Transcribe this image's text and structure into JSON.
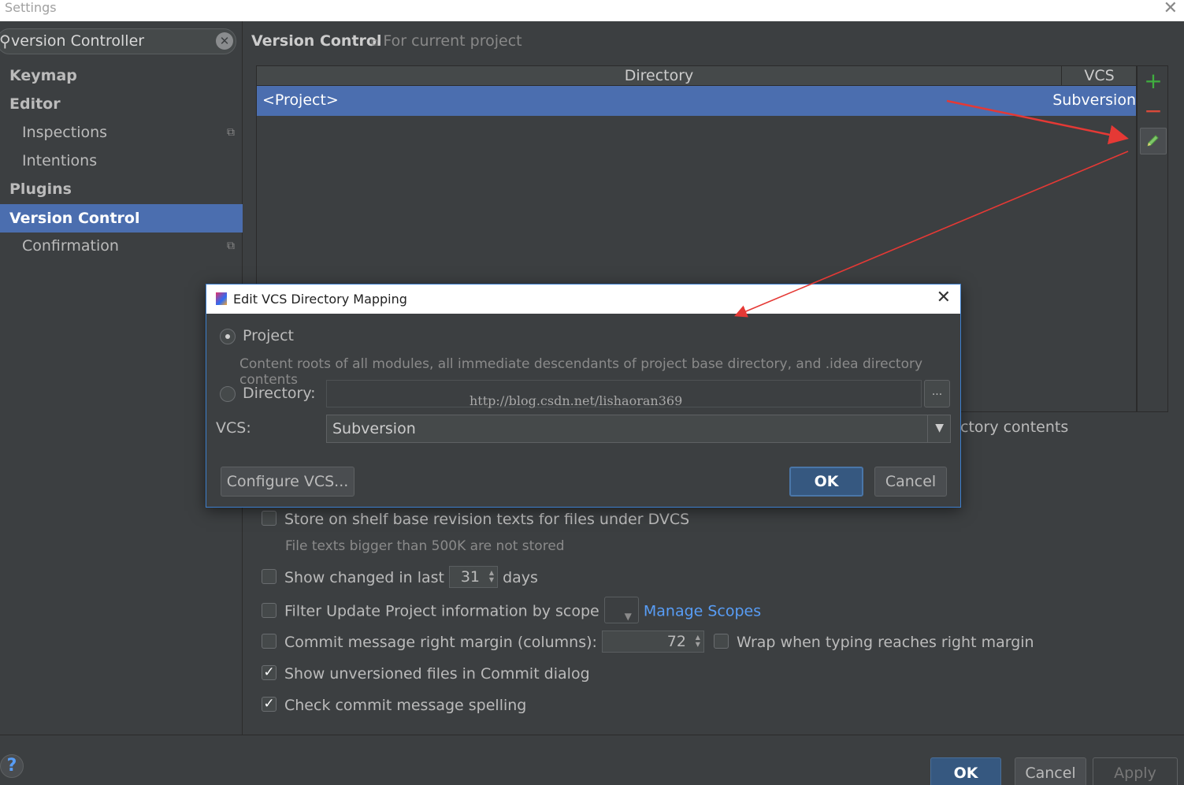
{
  "window": {
    "title": "Settings"
  },
  "search": {
    "value": "version Controller"
  },
  "sidebar": {
    "items": [
      {
        "label": "Keymap"
      },
      {
        "label": "Editor"
      },
      {
        "label": "Inspections"
      },
      {
        "label": "Intentions"
      },
      {
        "label": "Plugins"
      },
      {
        "label": "Version Control"
      },
      {
        "label": "Confirmation"
      }
    ]
  },
  "main": {
    "title": "Version Control",
    "subtitle": "For current project",
    "table": {
      "columns": [
        "Directory",
        "VCS"
      ],
      "rows": [
        {
          "directory": "<Project>",
          "vcs": "Subversion"
        }
      ]
    },
    "desc_tail": "ctory contents",
    "options": {
      "shelf_label": "Store on shelf base revision texts for files under DVCS",
      "shelf_hint": "File texts bigger than 500K are not stored",
      "show_changed_label": "Show changed in last",
      "show_changed_value": "31",
      "show_changed_suffix": "days",
      "filter_label": "Filter Update Project information by scope",
      "manage_scopes": "Manage Scopes",
      "margin_label": "Commit message right margin (columns):",
      "margin_value": "72",
      "wrap_label": "Wrap when typing reaches right margin",
      "unversioned_label": "Show unversioned files in Commit dialog",
      "spelling_label": "Check commit message spelling"
    }
  },
  "dialog": {
    "title": "Edit VCS Directory Mapping",
    "project_label": "Project",
    "project_hint": "Content roots of all modules, all immediate descendants of project base directory, and .idea directory contents",
    "directory_label": "Directory:",
    "browse_label": "...",
    "watermark": "http://blog.csdn.net/lishaoran369",
    "vcs_label": "VCS:",
    "vcs_value": "Subversion",
    "configure_label": "Configure VCS...",
    "ok_label": "OK",
    "cancel_label": "Cancel"
  },
  "footer": {
    "help_label": "?",
    "ok_label": "OK",
    "cancel_label": "Cancel",
    "apply_label": "Apply"
  },
  "colors": {
    "background": "#3c3f41",
    "selection": "#4b6eaf",
    "link": "#589df6",
    "add": "#3fae3f",
    "remove": "#d94a3a",
    "annotation_arrow": "#e53935"
  },
  "icons": [
    "search-icon",
    "clear-icon",
    "project-scope-icon",
    "add-icon",
    "remove-icon",
    "edit-icon",
    "close-icon",
    "app-icon",
    "help-icon"
  ]
}
